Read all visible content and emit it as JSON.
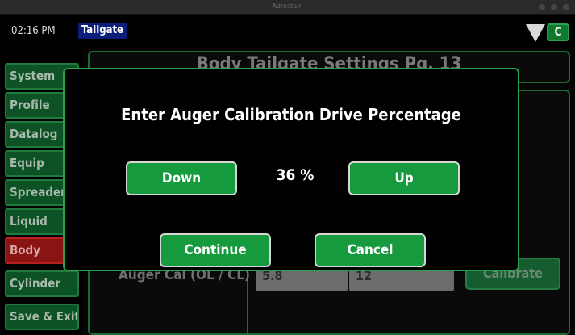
{
  "window": {
    "title": "Adrestain"
  },
  "status": {
    "time": "02:16 PM",
    "breadcrumb": "Tailgate",
    "badge": "C"
  },
  "sidebar": {
    "items": [
      {
        "label": "System"
      },
      {
        "label": "Profile"
      },
      {
        "label": "Datalog"
      },
      {
        "label": "Equip"
      },
      {
        "label": "Spreader"
      },
      {
        "label": "Liquid"
      },
      {
        "label": "Body"
      },
      {
        "label": "Cylinder"
      },
      {
        "label": "Save & Exit"
      }
    ],
    "active": "Body"
  },
  "page": {
    "title": "Body Tailgate Settings Pg. 13",
    "row_label": "Auger Cal (OL / CL)",
    "field_ol": "5.8",
    "field_cl": "12",
    "calibrate_label": "Calibrate"
  },
  "dialog": {
    "title": "Enter Auger Calibration Drive Percentage",
    "down_label": "Down",
    "value": "36 %",
    "up_label": "Up",
    "continue_label": "Continue",
    "cancel_label": "Cancel"
  },
  "colors": {
    "accent_green": "#169a3e",
    "active_red": "#8a1414",
    "breadcrumb_blue": "#0b1f7a"
  }
}
